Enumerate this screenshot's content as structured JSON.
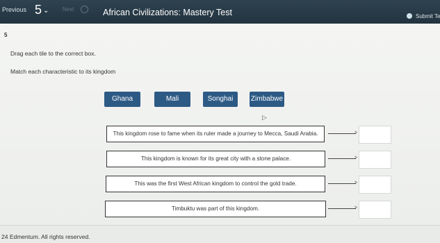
{
  "topbar": {
    "previous": "Previous",
    "question_number": "5",
    "next": "Next",
    "title": "African Civilizations: Mastery Test",
    "submit": "Submit Te"
  },
  "question": {
    "number": "5",
    "instruction": "Drag each tile to the correct box.",
    "prompt": "Match each characteristic to its kingdom"
  },
  "tiles": [
    "Ghana",
    "Mali",
    "Songhai",
    "Zimbabwe"
  ],
  "statements": [
    "This kingdom rose to fame when its ruler made a journey to Mecca, Saudi Arabia.",
    "This kingdom is known for its great city with a stone palace.",
    "This was the first West African kingdom to control the gold trade.",
    "Timbuktu was part of this kingdom."
  ],
  "footer": {
    "copyright": "24 Edmentum. All rights reserved."
  },
  "icons": {
    "dropdown": "chevron-down-icon",
    "submit": "check-circle-icon",
    "arrow": "arrow-right-icon",
    "cursor": "cursor-icon"
  },
  "colors": {
    "topbar": "#2f4350",
    "tile": "#2d5a85"
  }
}
